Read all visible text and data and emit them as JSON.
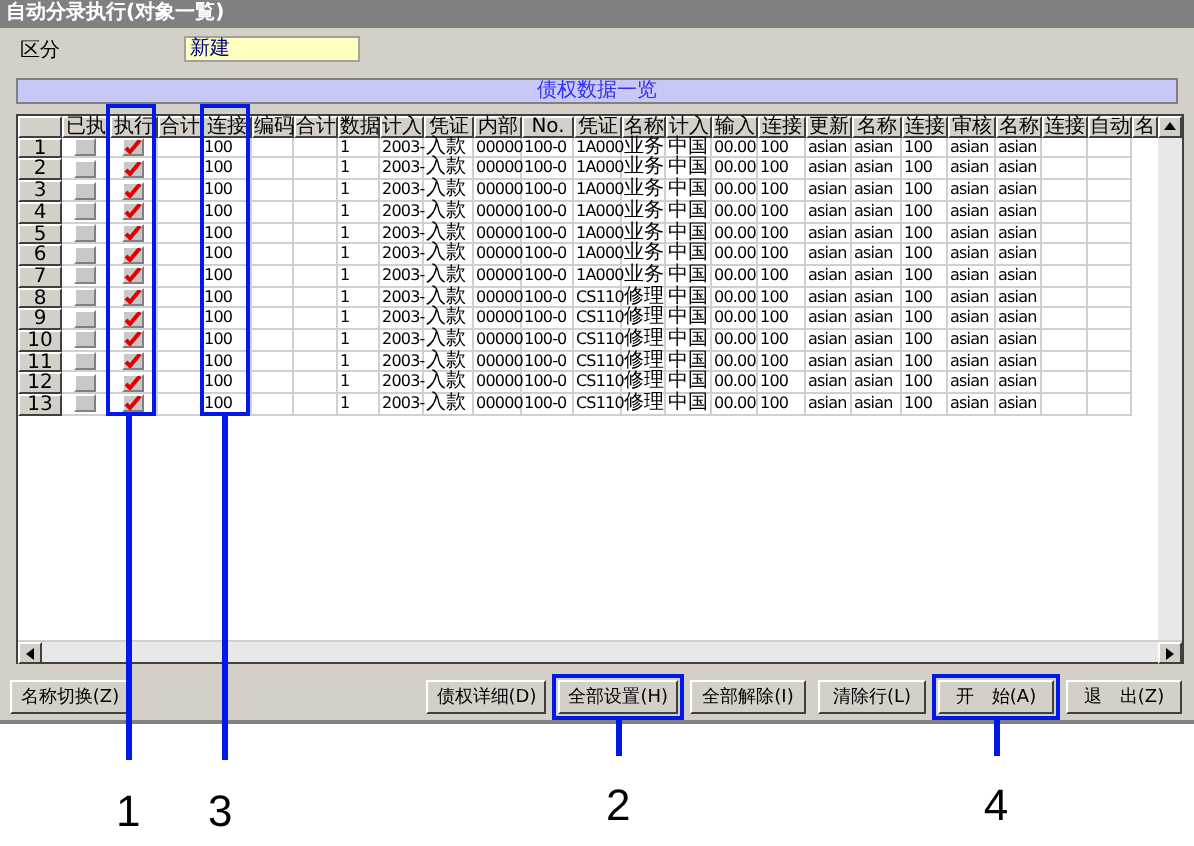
{
  "window": {
    "title": "自动分录执行(对象一覧)"
  },
  "field": {
    "label": "区分",
    "value": "新建"
  },
  "banner": "债权数据一览",
  "columns": [
    "已执",
    "执行",
    "合计",
    "连接",
    "编码",
    "合计",
    "数据",
    "计入",
    "凭证",
    "内部",
    "No.",
    "凭证",
    "名称",
    "计入",
    "输入",
    "连接",
    "更新",
    "名称",
    "连接",
    "审核",
    "名称",
    "连接",
    "自动",
    "名"
  ],
  "rows": [
    {
      "no": "1",
      "done": false,
      "exec": true,
      "cells": [
        "",
        "100",
        "",
        "",
        "1",
        "2003-",
        "入款",
        "00000",
        "100-0",
        "1A000",
        "业务",
        "中国",
        "00.00",
        "100",
        "asian",
        "asian",
        "100",
        "asian",
        "asian",
        "",
        ""
      ]
    },
    {
      "no": "2",
      "done": false,
      "exec": true,
      "cells": [
        "",
        "100",
        "",
        "",
        "1",
        "2003-",
        "入款",
        "00000",
        "100-0",
        "1A000",
        "业务",
        "中国",
        "00.00",
        "100",
        "asian",
        "asian",
        "100",
        "asian",
        "asian",
        "",
        ""
      ]
    },
    {
      "no": "3",
      "done": false,
      "exec": true,
      "cells": [
        "",
        "100",
        "",
        "",
        "1",
        "2003-",
        "入款",
        "00000",
        "100-0",
        "1A000",
        "业务",
        "中国",
        "00.00",
        "100",
        "asian",
        "asian",
        "100",
        "asian",
        "asian",
        "",
        ""
      ]
    },
    {
      "no": "4",
      "done": false,
      "exec": true,
      "cells": [
        "",
        "100",
        "",
        "",
        "1",
        "2003-",
        "入款",
        "00000",
        "100-0",
        "1A000",
        "业务",
        "中国",
        "00.00",
        "100",
        "asian",
        "asian",
        "100",
        "asian",
        "asian",
        "",
        ""
      ]
    },
    {
      "no": "5",
      "done": false,
      "exec": true,
      "cells": [
        "",
        "100",
        "",
        "",
        "1",
        "2003-",
        "入款",
        "00000",
        "100-0",
        "1A000",
        "业务",
        "中国",
        "00.00",
        "100",
        "asian",
        "asian",
        "100",
        "asian",
        "asian",
        "",
        ""
      ]
    },
    {
      "no": "6",
      "done": false,
      "exec": true,
      "cells": [
        "",
        "100",
        "",
        "",
        "1",
        "2003-",
        "入款",
        "00000",
        "100-0",
        "1A000",
        "业务",
        "中国",
        "00.00",
        "100",
        "asian",
        "asian",
        "100",
        "asian",
        "asian",
        "",
        ""
      ]
    },
    {
      "no": "7",
      "done": false,
      "exec": true,
      "cells": [
        "",
        "100",
        "",
        "",
        "1",
        "2003-",
        "入款",
        "00000",
        "100-0",
        "1A000",
        "业务",
        "中国",
        "00.00",
        "100",
        "asian",
        "asian",
        "100",
        "asian",
        "asian",
        "",
        ""
      ]
    },
    {
      "no": "8",
      "done": false,
      "exec": true,
      "cells": [
        "",
        "100",
        "",
        "",
        "1",
        "2003-",
        "入款",
        "00000",
        "100-0",
        "CS110",
        "修理",
        "中国",
        "00.00",
        "100",
        "asian",
        "asian",
        "100",
        "asian",
        "asian",
        "",
        ""
      ]
    },
    {
      "no": "9",
      "done": false,
      "exec": true,
      "cells": [
        "",
        "100",
        "",
        "",
        "1",
        "2003-",
        "入款",
        "00000",
        "100-0",
        "CS110",
        "修理",
        "中国",
        "00.00",
        "100",
        "asian",
        "asian",
        "100",
        "asian",
        "asian",
        "",
        ""
      ]
    },
    {
      "no": "10",
      "done": false,
      "exec": true,
      "cells": [
        "",
        "100",
        "",
        "",
        "1",
        "2003-",
        "入款",
        "00000",
        "100-0",
        "CS110",
        "修理",
        "中国",
        "00.00",
        "100",
        "asian",
        "asian",
        "100",
        "asian",
        "asian",
        "",
        ""
      ]
    },
    {
      "no": "11",
      "done": false,
      "exec": true,
      "cells": [
        "",
        "100",
        "",
        "",
        "1",
        "2003-",
        "入款",
        "00000",
        "100-0",
        "CS110",
        "修理",
        "中国",
        "00.00",
        "100",
        "asian",
        "asian",
        "100",
        "asian",
        "asian",
        "",
        ""
      ]
    },
    {
      "no": "12",
      "done": false,
      "exec": true,
      "cells": [
        "",
        "100",
        "",
        "",
        "1",
        "2003-",
        "入款",
        "00000",
        "100-0",
        "CS110",
        "修理",
        "中国",
        "00.00",
        "100",
        "asian",
        "asian",
        "100",
        "asian",
        "asian",
        "",
        ""
      ]
    },
    {
      "no": "13",
      "done": false,
      "exec": true,
      "cells": [
        "",
        "100",
        "",
        "",
        "1",
        "2003-",
        "入款",
        "00000",
        "100-0",
        "CS110",
        "修理",
        "中国",
        "00.00",
        "100",
        "asian",
        "asian",
        "100",
        "asian",
        "asian",
        "",
        ""
      ]
    }
  ],
  "left_button": "名称切换(Z)",
  "buttons": [
    {
      "label": "债权详细(D)"
    },
    {
      "label": "全部设置(H)",
      "callout": "2"
    },
    {
      "label": "全部解除(I)"
    },
    {
      "label": "清除行(L)"
    },
    {
      "label": "开　始(A)",
      "callout": "4"
    },
    {
      "label": "退　出(Z)"
    }
  ],
  "callouts": [
    "1",
    "3"
  ]
}
